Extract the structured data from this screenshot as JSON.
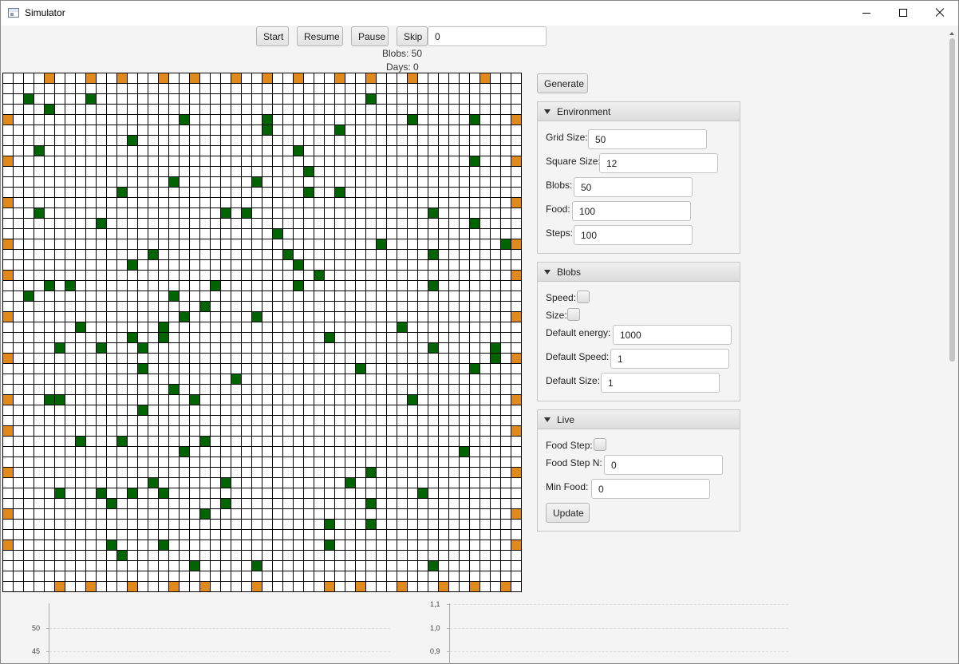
{
  "window": {
    "title": "Simulator"
  },
  "toolbar": {
    "start_label": "Start",
    "resume_label": "Resume",
    "pause_label": "Pause",
    "skip_label": "Skip",
    "skip_value": "0"
  },
  "status": {
    "blobs": "Blobs: 50",
    "days": "Days: 0"
  },
  "generate_label": "Generate",
  "grid": {
    "size": 50,
    "colors": {
      "empty": "#ffffff",
      "blob": "#e08a1e",
      "food": "#006400",
      "line": "#000000"
    },
    "blob_cells": [
      [
        0,
        4
      ],
      [
        0,
        8
      ],
      [
        0,
        11
      ],
      [
        0,
        15
      ],
      [
        0,
        18
      ],
      [
        0,
        22
      ],
      [
        0,
        25
      ],
      [
        0,
        28
      ],
      [
        0,
        32
      ],
      [
        0,
        35
      ],
      [
        0,
        39
      ],
      [
        0,
        46
      ],
      [
        4,
        0
      ],
      [
        4,
        49
      ],
      [
        8,
        0
      ],
      [
        8,
        49
      ],
      [
        12,
        0
      ],
      [
        12,
        49
      ],
      [
        16,
        0
      ],
      [
        16,
        49
      ],
      [
        19,
        0
      ],
      [
        19,
        49
      ],
      [
        23,
        0
      ],
      [
        23,
        49
      ],
      [
        27,
        0
      ],
      [
        27,
        49
      ],
      [
        31,
        0
      ],
      [
        31,
        49
      ],
      [
        34,
        0
      ],
      [
        34,
        49
      ],
      [
        38,
        0
      ],
      [
        38,
        49
      ],
      [
        42,
        0
      ],
      [
        42,
        49
      ],
      [
        45,
        0
      ],
      [
        45,
        49
      ],
      [
        49,
        5
      ],
      [
        49,
        8
      ],
      [
        49,
        12
      ],
      [
        49,
        16
      ],
      [
        49,
        19
      ],
      [
        49,
        24
      ],
      [
        49,
        31
      ],
      [
        49,
        34
      ],
      [
        49,
        38
      ],
      [
        49,
        42
      ],
      [
        49,
        45
      ],
      [
        49,
        48
      ]
    ],
    "food_cells": [
      [
        2,
        2
      ],
      [
        2,
        8
      ],
      [
        2,
        35
      ],
      [
        3,
        4
      ],
      [
        4,
        17
      ],
      [
        4,
        25
      ],
      [
        4,
        39
      ],
      [
        4,
        45
      ],
      [
        5,
        25
      ],
      [
        5,
        32
      ],
      [
        6,
        12
      ],
      [
        7,
        3
      ],
      [
        7,
        28
      ],
      [
        8,
        45
      ],
      [
        9,
        29
      ],
      [
        10,
        16
      ],
      [
        10,
        24
      ],
      [
        11,
        11
      ],
      [
        11,
        29
      ],
      [
        11,
        32
      ],
      [
        13,
        3
      ],
      [
        13,
        21
      ],
      [
        13,
        23
      ],
      [
        13,
        41
      ],
      [
        14,
        9
      ],
      [
        14,
        45
      ],
      [
        15,
        26
      ],
      [
        16,
        36
      ],
      [
        16,
        48
      ],
      [
        17,
        14
      ],
      [
        17,
        27
      ],
      [
        17,
        41
      ],
      [
        18,
        12
      ],
      [
        18,
        28
      ],
      [
        19,
        30
      ],
      [
        20,
        4
      ],
      [
        20,
        6
      ],
      [
        20,
        20
      ],
      [
        20,
        28
      ],
      [
        20,
        41
      ],
      [
        21,
        2
      ],
      [
        21,
        16
      ],
      [
        22,
        19
      ],
      [
        23,
        17
      ],
      [
        23,
        24
      ],
      [
        24,
        7
      ],
      [
        24,
        15
      ],
      [
        24,
        38
      ],
      [
        25,
        12
      ],
      [
        25,
        15
      ],
      [
        25,
        31
      ],
      [
        26,
        5
      ],
      [
        26,
        9
      ],
      [
        26,
        13
      ],
      [
        26,
        41
      ],
      [
        26,
        47
      ],
      [
        27,
        47
      ],
      [
        28,
        13
      ],
      [
        28,
        34
      ],
      [
        28,
        45
      ],
      [
        29,
        22
      ],
      [
        30,
        16
      ],
      [
        31,
        4
      ],
      [
        31,
        5
      ],
      [
        31,
        18
      ],
      [
        31,
        39
      ],
      [
        32,
        13
      ],
      [
        35,
        7
      ],
      [
        35,
        11
      ],
      [
        35,
        19
      ],
      [
        36,
        17
      ],
      [
        36,
        44
      ],
      [
        38,
        35
      ],
      [
        39,
        14
      ],
      [
        39,
        21
      ],
      [
        39,
        33
      ],
      [
        40,
        5
      ],
      [
        40,
        9
      ],
      [
        40,
        12
      ],
      [
        40,
        15
      ],
      [
        40,
        40
      ],
      [
        41,
        10
      ],
      [
        41,
        21
      ],
      [
        41,
        35
      ],
      [
        42,
        19
      ],
      [
        43,
        31
      ],
      [
        43,
        35
      ],
      [
        45,
        10
      ],
      [
        45,
        15
      ],
      [
        45,
        31
      ],
      [
        46,
        11
      ],
      [
        47,
        18
      ],
      [
        47,
        24
      ],
      [
        47,
        41
      ]
    ]
  },
  "environment": {
    "title": "Environment",
    "grid_size_label": "Grid Size:",
    "grid_size": "50",
    "square_size_label": "Square Size:",
    "square_size": "12",
    "blobs_label": "Blobs:",
    "blobs": "50",
    "food_label": "Food:",
    "food": "100",
    "steps_label": "Steps:",
    "steps": "100"
  },
  "blobs_panel": {
    "title": "Blobs",
    "speed_label": "Speed:",
    "size_label": "Size:",
    "default_energy_label": "Default energy:",
    "default_energy": "1000",
    "default_speed_label": "Default Speed:",
    "default_speed": "1",
    "default_size_label": "Default Size:",
    "default_size": "1"
  },
  "live": {
    "title": "Live",
    "food_step_label": "Food Step:",
    "food_step_n_label": "Food Step N:",
    "food_step_n": "0",
    "min_food_label": "Min Food:",
    "min_food": "0",
    "update_label": "Update"
  },
  "charts": {
    "left": {
      "ticks": [
        "50",
        "45"
      ]
    },
    "right": {
      "ticks": [
        "1,1",
        "1,0",
        "0,9"
      ]
    }
  }
}
